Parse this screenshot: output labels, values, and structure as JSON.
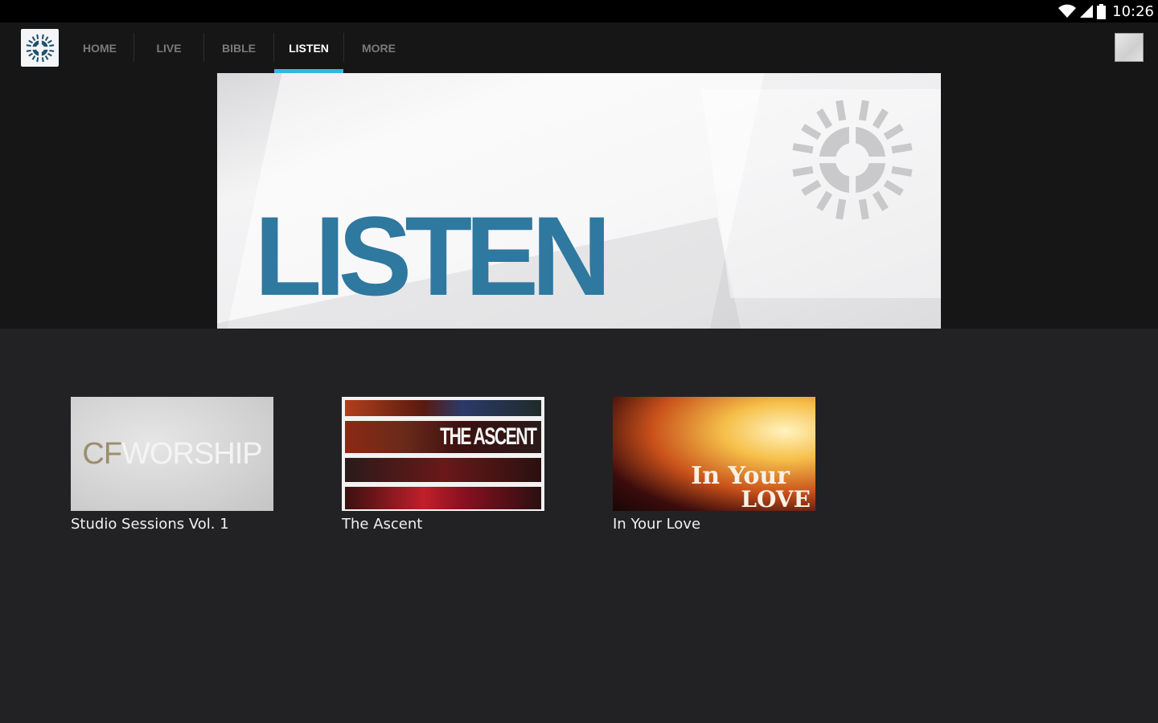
{
  "status_bar": {
    "time": "10:26",
    "icons": [
      "wifi-icon",
      "signal-icon",
      "battery-icon"
    ]
  },
  "action_bar": {
    "logo": "app-logo",
    "tabs": [
      {
        "label": "HOME",
        "active": false
      },
      {
        "label": "LIVE",
        "active": false
      },
      {
        "label": "BIBLE",
        "active": false
      },
      {
        "label": "LISTEN",
        "active": true
      },
      {
        "label": "MORE",
        "active": false
      }
    ],
    "accent_color": "#33b5e5"
  },
  "hero": {
    "title": "LISTEN",
    "title_color": "#2f789f"
  },
  "albums": [
    {
      "title": "Studio Sessions Vol. 1",
      "cover_text_a": "CF",
      "cover_text_b": "WORSHIP"
    },
    {
      "title": "The Ascent",
      "cover_text": "THE ASCENT"
    },
    {
      "title": "In Your Love",
      "cover_text_a": "In Your",
      "cover_text_b": "LOVE"
    }
  ]
}
